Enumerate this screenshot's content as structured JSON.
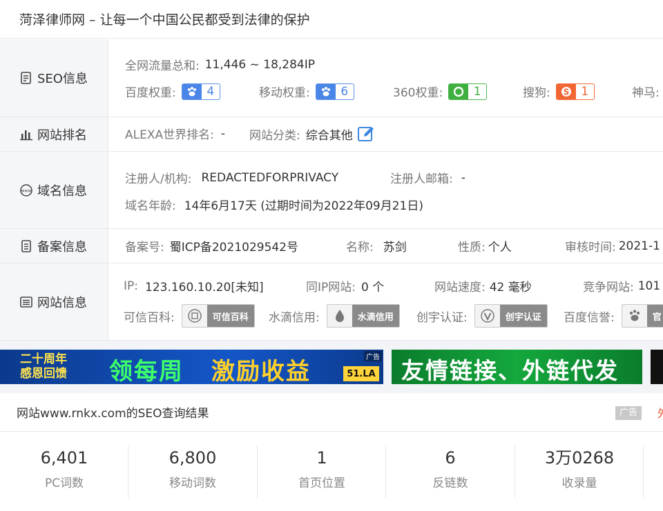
{
  "header": {
    "title": "菏泽律师网 – 让每一个中国公民都受到法律的保护"
  },
  "seo": {
    "label": "SEO信息",
    "traffic_label": "全网流量总和:",
    "traffic_value": "11,446 ~ 18,284IP",
    "baidu_weight_label": "百度权重:",
    "baidu_weight": "4",
    "mobile_weight_label": "移动权重:",
    "mobile_weight": "6",
    "w360_label": "360权重:",
    "w360": "1",
    "sogou_label": "搜狗:",
    "sogou": "1",
    "shenma_label": "神马:"
  },
  "ranking": {
    "label": "网站排名",
    "alexa_label": "ALEXA世界排名:",
    "alexa_value": "-",
    "category_label": "网站分类:",
    "category_value": "综合其他"
  },
  "domain": {
    "label": "域名信息",
    "registrant_label": "注册人/机构:",
    "registrant_value": "REDACTEDFORPRIVACY",
    "email_label": "注册人邮箱:",
    "email_value": "-",
    "age_label": "域名年龄:",
    "age_value": "14年6月17天 (过期时间为2022年09月21日)"
  },
  "icp": {
    "label": "备案信息",
    "number_label": "备案号:",
    "number_value": "蜀ICP备2021029542号",
    "name_label": "名称:",
    "name_value": "苏剑",
    "type_label": "性质:",
    "type_value": "个人",
    "review_label": "审核时间:",
    "review_value": "2021-1"
  },
  "site": {
    "label": "网站信息",
    "ip_label": "IP:",
    "ip_value": "123.160.10.20[未知]",
    "same_ip_label": "同IP网站:",
    "same_ip_value": "0 个",
    "speed_label": "网站速度:",
    "speed_value": "42 毫秒",
    "compete_label": "竞争网站:",
    "compete_value": "101",
    "kexin_label": "可信百科:",
    "kexin_badge": "可信百科",
    "shuidi_label": "水滴信用:",
    "shuidi_badge": "水滴信用",
    "chuangyu_label": "创宇认证:",
    "chuangyu_badge": "创宇认证",
    "baidu_xinyu_label": "百度信誉:",
    "baidu_xinyu_badge": "官"
  },
  "ads": {
    "ad1_line1": "二十周年",
    "ad1_line2": "感恩回馈",
    "ad1_main": "领每周",
    "ad1_main2": "激励收益",
    "ad1_brand": "51.LA",
    "ad_tag": "广告",
    "ad2_main": "友情链接、外链代发"
  },
  "seo_result": {
    "title": "网站www.rnkx.com的SEO查询结果",
    "ad_label": "广告",
    "ad_right": "外",
    "stats": [
      {
        "value": "6,401",
        "label": "PC词数"
      },
      {
        "value": "6,800",
        "label": "移动词数"
      },
      {
        "value": "1",
        "label": "首页位置"
      },
      {
        "value": "6",
        "label": "反链数"
      },
      {
        "value": "3万0268",
        "label": "收录量"
      }
    ]
  }
}
